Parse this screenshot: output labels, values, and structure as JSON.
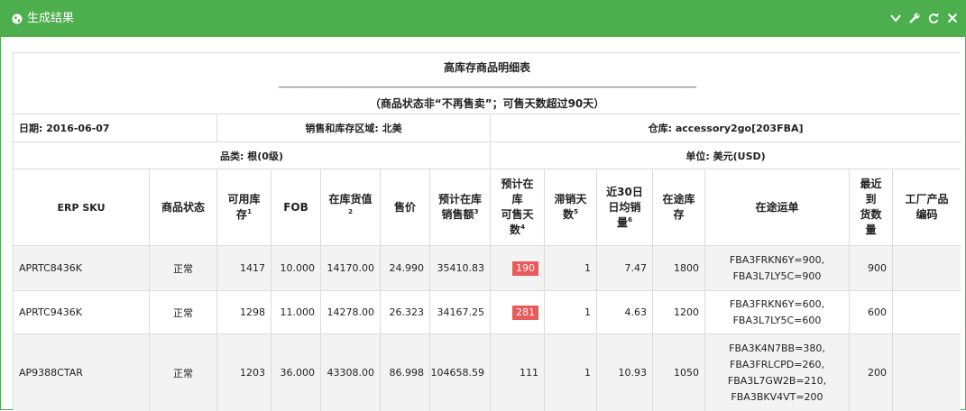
{
  "window": {
    "title": "生成结果"
  },
  "report": {
    "title": "高库存商品明细表",
    "dash_line": "--------------------------------------------------------------------------------------------------------------------------------------------------------------------------------------------------------------",
    "subtitle": "（商品状态非“不再售卖”；可售天数超过90天）",
    "date": "日期: 2016-06-07",
    "region": "销售和库存区域: 北美",
    "warehouse": "仓库: accessory2go[203FBA]",
    "category": "品类: 根(0级)",
    "unit": "单位: 美元(USD)"
  },
  "columns": [
    {
      "lines": [
        "ERP SKU"
      ]
    },
    {
      "lines": [
        "商品状态"
      ]
    },
    {
      "lines": [
        "可用库",
        "存"
      ],
      "sup": "1"
    },
    {
      "lines": [
        "FOB"
      ]
    },
    {
      "lines": [
        "在库货值",
        ""
      ],
      "sup": "2"
    },
    {
      "lines": [
        "售价"
      ]
    },
    {
      "lines": [
        "预计在库",
        "销售额"
      ],
      "sup": "3"
    },
    {
      "lines": [
        "预计在",
        "库",
        "可售天",
        "数"
      ],
      "sup": "4"
    },
    {
      "lines": [
        "滞销天",
        "数"
      ],
      "sup": "5"
    },
    {
      "lines": [
        "近30日",
        "日均销",
        "量"
      ],
      "sup": "6"
    },
    {
      "lines": [
        "在途库",
        "存"
      ]
    },
    {
      "lines": [
        "在途运单"
      ]
    },
    {
      "lines": [
        "最近",
        "到",
        "货数",
        "量"
      ]
    },
    {
      "lines": [
        "工厂产品",
        "编码"
      ]
    }
  ],
  "rows": [
    {
      "sku": "APRTC8436K",
      "status": "正常",
      "available": "1417",
      "fob": "10.000",
      "stock_value": "14170.00",
      "price": "24.990",
      "est_sales": "35410.83",
      "days": "190",
      "days_highlight": true,
      "slow_days": "1",
      "avg30": "7.47",
      "in_transit": "1800",
      "transit_orders": [
        "FBA3FRKN6Y=900,",
        "FBA3L7LY5C=900"
      ],
      "last_arrival": "900",
      "factory_code": ""
    },
    {
      "sku": "APRTC9436K",
      "status": "正常",
      "available": "1298",
      "fob": "11.000",
      "stock_value": "14278.00",
      "price": "26.323",
      "est_sales": "34167.25",
      "days": "281",
      "days_highlight": true,
      "slow_days": "1",
      "avg30": "4.63",
      "in_transit": "1200",
      "transit_orders": [
        "FBA3FRKN6Y=600,",
        "FBA3L7LY5C=600"
      ],
      "last_arrival": "600",
      "factory_code": ""
    },
    {
      "sku": "AP9388CTAR",
      "status": "正常",
      "available": "1203",
      "fob": "36.000",
      "stock_value": "43308.00",
      "price": "86.998",
      "est_sales": "104658.59",
      "days": "111",
      "days_highlight": false,
      "slow_days": "1",
      "avg30": "10.93",
      "in_transit": "1050",
      "transit_orders": [
        "FBA3K4N7BB=380,",
        "FBA3FRLCPD=260,",
        "FBA3L7GW2B=210,",
        "FBA3BKV4VT=200"
      ],
      "last_arrival": "200",
      "factory_code": ""
    }
  ],
  "colors": {
    "titlebar": "#4cae4c",
    "highlight": "#e85b5b",
    "row_alt": "#f3f3f3"
  },
  "icons": {
    "title": "globe-icon",
    "tools": [
      "chevron-down-icon",
      "wrench-icon",
      "refresh-icon",
      "close-icon"
    ]
  }
}
